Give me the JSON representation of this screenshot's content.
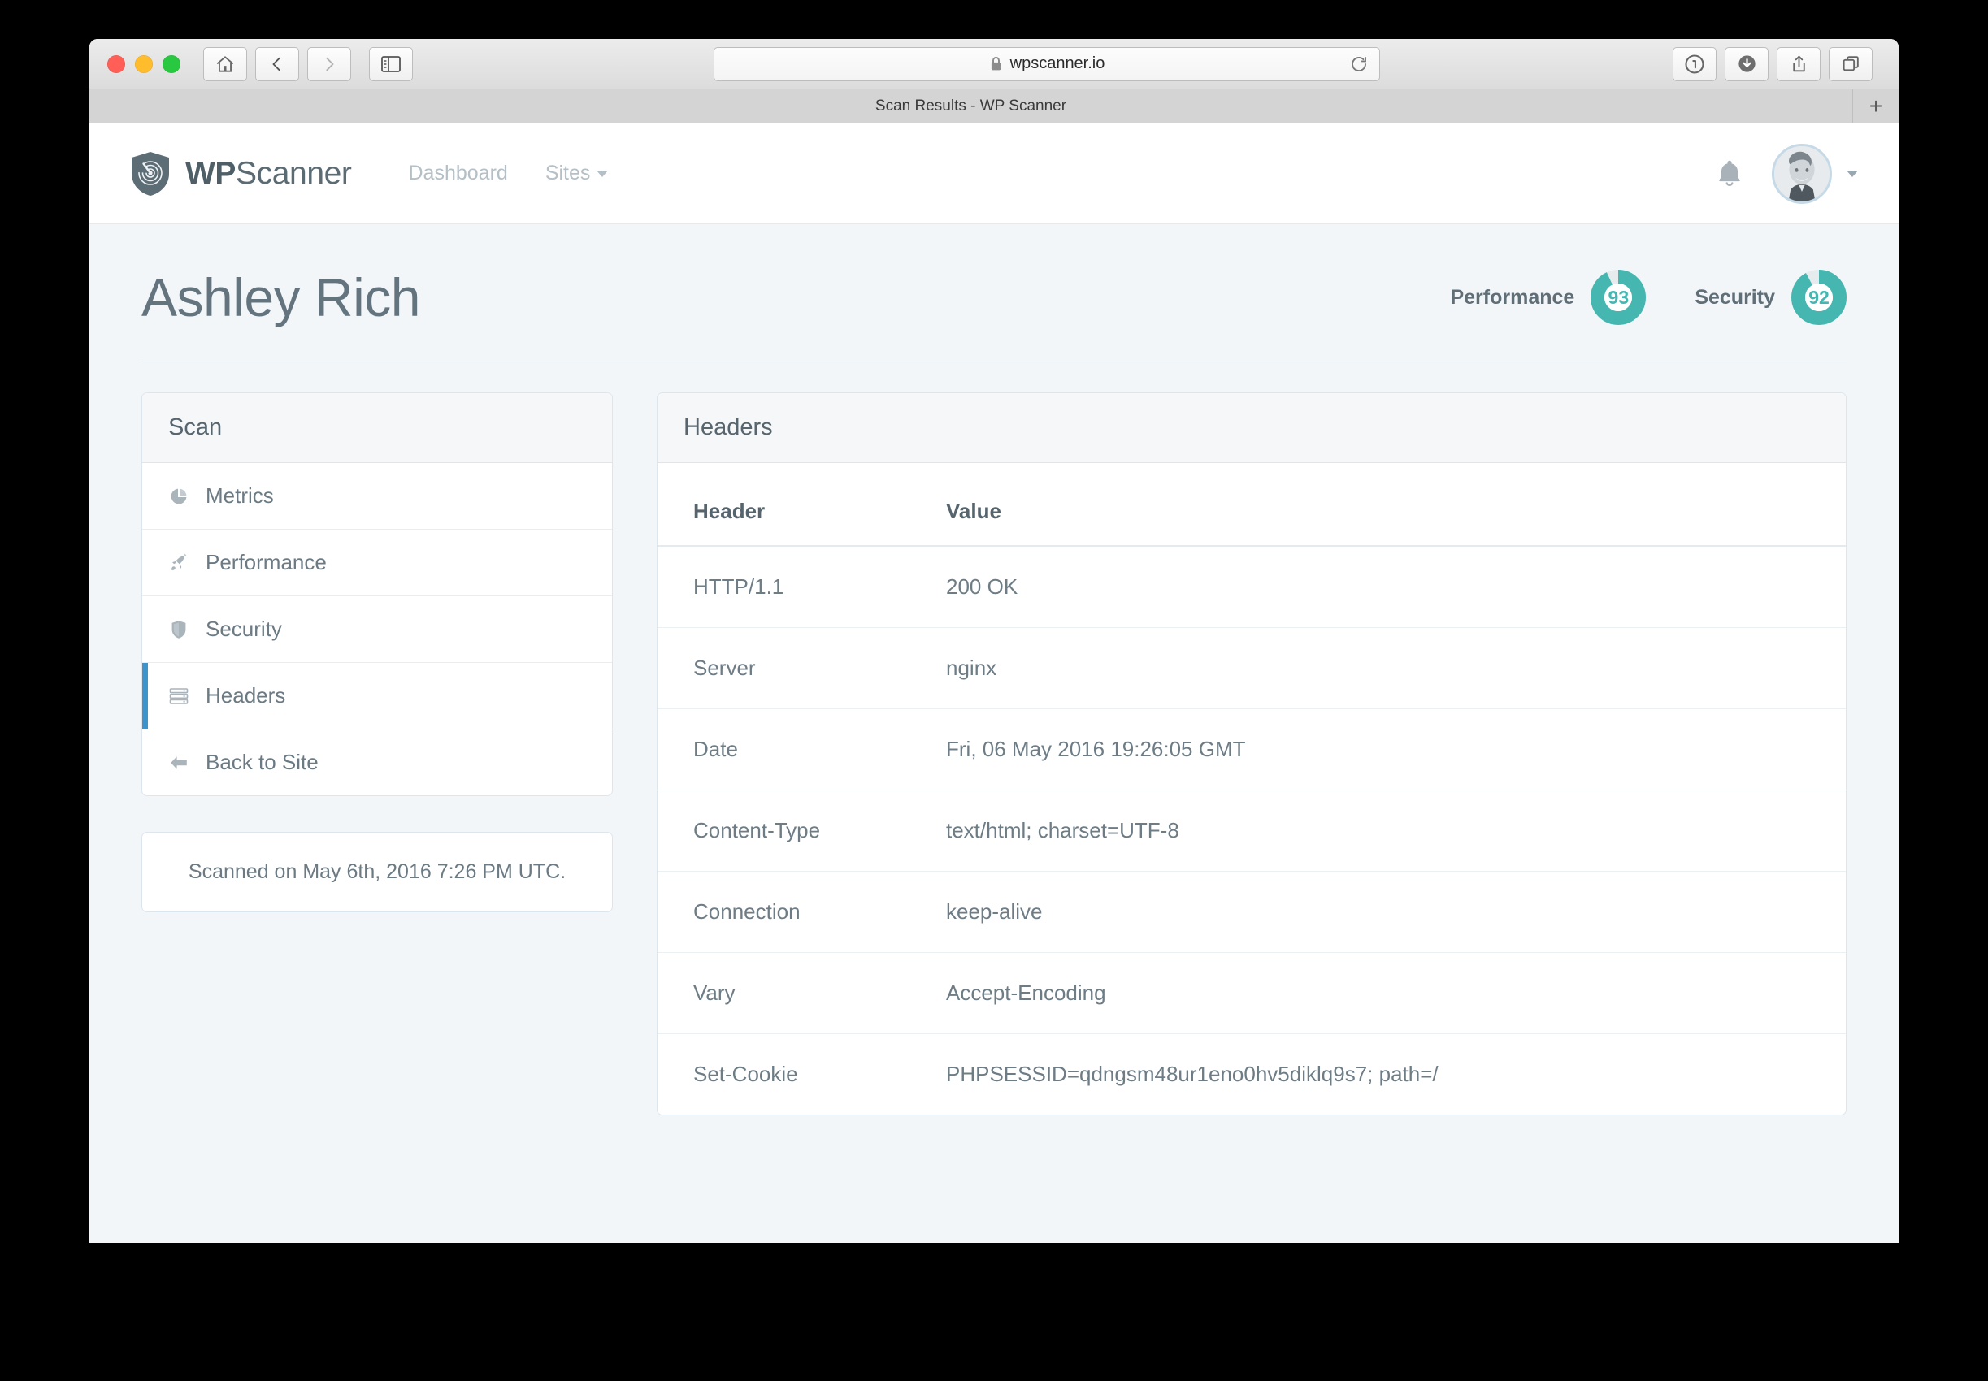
{
  "browser": {
    "url": "wpscanner.io",
    "lock_icon": "lock-icon",
    "tab_title": "Scan Results - WP Scanner",
    "new_tab_label": "+",
    "buttons": {
      "home": "home-icon",
      "back": "back-icon",
      "forward": "forward-icon",
      "sidebar": "sidebar-icon",
      "reload": "reload-icon",
      "password": "1password-icon",
      "downloads": "downloads-icon",
      "share": "share-icon",
      "tabs": "tab-overview-icon"
    }
  },
  "header": {
    "brand_bold": "WP",
    "brand_light": "Scanner",
    "nav": [
      {
        "label": "Dashboard",
        "has_caret": false
      },
      {
        "label": "Sites",
        "has_caret": true
      }
    ],
    "bell_icon": "bell-icon",
    "avatar": "user-avatar",
    "user_caret": "chevron-down-icon"
  },
  "page": {
    "title": "Ashley Rich",
    "scores": [
      {
        "label": "Performance",
        "value": "93",
        "percent": 93
      },
      {
        "label": "Security",
        "value": "92",
        "percent": 92
      }
    ]
  },
  "sidebar": {
    "title": "Scan",
    "items": [
      {
        "label": "Metrics",
        "icon": "pie-chart-icon",
        "active": false
      },
      {
        "label": "Performance",
        "icon": "rocket-icon",
        "active": false
      },
      {
        "label": "Security",
        "icon": "shield-icon",
        "active": false
      },
      {
        "label": "Headers",
        "icon": "server-list-icon",
        "active": true
      },
      {
        "label": "Back to Site",
        "icon": "arrow-left-icon",
        "active": false
      }
    ],
    "scanned_on": "Scanned on May 6th, 2016 7:26 PM UTC."
  },
  "headers_panel": {
    "title": "Headers",
    "columns": [
      "Header",
      "Value"
    ],
    "rows": [
      {
        "header": "HTTP/1.1",
        "value": "200 OK"
      },
      {
        "header": "Server",
        "value": "nginx"
      },
      {
        "header": "Date",
        "value": "Fri, 06 May 2016 19:26:05 GMT"
      },
      {
        "header": "Content-Type",
        "value": "text/html; charset=UTF-8"
      },
      {
        "header": "Connection",
        "value": "keep-alive"
      },
      {
        "header": "Vary",
        "value": "Accept-Encoding"
      },
      {
        "header": "Set-Cookie",
        "value": "PHPSESSID=qdngsm48ur1eno0hv5diklq9s7; path=/"
      }
    ]
  },
  "colors": {
    "accent_teal": "#45b6b0",
    "accent_blue": "#3d94cc",
    "page_bg": "#f2f6f9",
    "text_slate": "#63747e"
  }
}
